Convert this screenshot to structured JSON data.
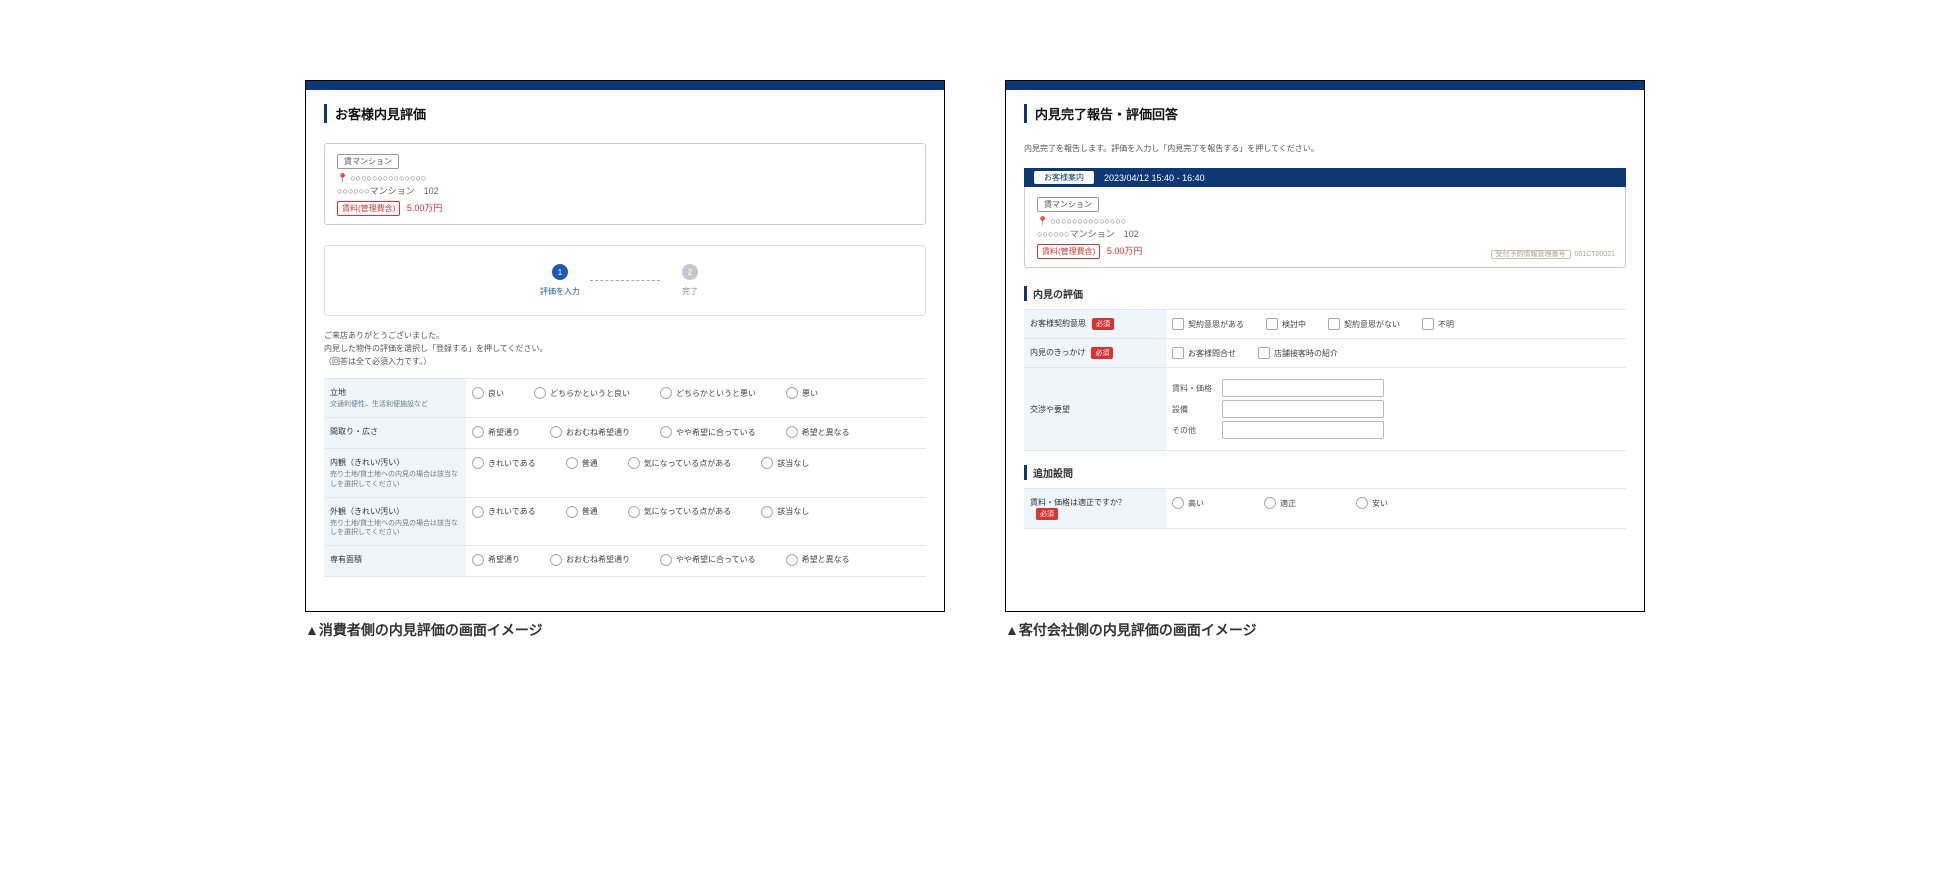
{
  "left": {
    "title": "お客様内見評価",
    "property": {
      "tag": "賃マンション",
      "address": "○○○○○○○○○○○○○○",
      "building": "○○○○○○マンション　102",
      "rent_tag": "賃料(管理費含)",
      "rent_value": "5.00万円"
    },
    "stepper": {
      "step1_num": "1",
      "step1_label": "評価を入力",
      "step2_num": "2",
      "step2_label": "完了"
    },
    "intro_l1": "ご来店ありがとうございました。",
    "intro_l2": "内見した物件の評価を選択し「登録する」を押してください。",
    "intro_l3": "（回答は全て必須入力です。）",
    "rows": [
      {
        "main": "立地",
        "sub": "交通利便性、生活利便施設など",
        "opts": [
          "良い",
          "どちらかというと良い",
          "どちらかというと悪い",
          "悪い"
        ]
      },
      {
        "main": "間取り・広さ",
        "sub": "",
        "opts": [
          "希望通り",
          "おおむね希望通り",
          "やや希望に合っている",
          "希望と異なる"
        ]
      },
      {
        "main": "内観（きれい/汚い）",
        "sub": "売り土地/貸土地への内見の場合は該当なしを選択してください",
        "opts": [
          "きれいである",
          "普通",
          "気になっている点がある",
          "該当なし"
        ]
      },
      {
        "main": "外観（きれい/汚い）",
        "sub": "売り土地/貸土地への内見の場合は該当なしを選択してください",
        "opts": [
          "きれいである",
          "普通",
          "気になっている点がある",
          "該当なし"
        ]
      },
      {
        "main": "専有面積",
        "sub": "",
        "opts": [
          "希望通り",
          "おおむね希望通り",
          "やや希望に合っている",
          "希望と異なる"
        ]
      }
    ],
    "caption": "▲消費者側の内見評価の画面イメージ"
  },
  "right": {
    "title": "内見完了報告・評価回答",
    "guide": "内見完了を報告します。評価を入力し「内見完了を報告する」を押してください。",
    "banner_badge": "お客様案内",
    "banner_time": "2023/04/12  15:40 - 16:40",
    "property": {
      "tag": "賃マンション",
      "address": "○○○○○○○○○○○○○○",
      "building": "○○○○○○マンション　102",
      "rent_tag": "賃料(管理費含)",
      "rent_value": "5.00万円",
      "reserve_tag": "受付予約情報管理番号",
      "reserve_num": "001CT00021"
    },
    "eval_title": "内見の評価",
    "required": "必須",
    "intent": {
      "label": "お客様契約意思",
      "opts": [
        "契約意思がある",
        "検討中",
        "契約意思がない",
        "不明"
      ]
    },
    "trigger": {
      "label": "内見のきっかけ",
      "opts": [
        "お客様問合せ",
        "店舗接客時の紹介"
      ]
    },
    "neg": {
      "label": "交渉や要望",
      "fields": [
        "賃料・価格",
        "設備",
        "その他"
      ]
    },
    "add_title": "追加設問",
    "price_q": {
      "label": "賃料・価格は適正ですか？",
      "opts": [
        "高い",
        "適正",
        "安い"
      ]
    },
    "caption": "▲客付会社側の内見評価の画面イメージ"
  }
}
